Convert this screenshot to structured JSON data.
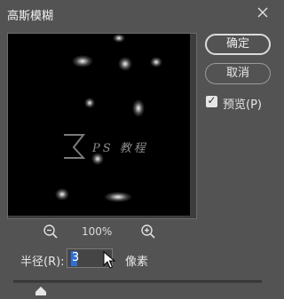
{
  "window": {
    "title": "高斯模糊"
  },
  "preview": {
    "zoom_level": "100%",
    "watermark_text": "PS 教程"
  },
  "buttons": {
    "ok": "确定",
    "cancel": "取消"
  },
  "preview_toggle": {
    "label": "预览(P)",
    "checked": true
  },
  "radius": {
    "label": "半径(R):",
    "value": "3",
    "unit": "像素",
    "slider_value": 3
  },
  "colors": {
    "background": "#535353",
    "preview": "#000000",
    "selection": "#2f6fd6"
  },
  "icons": [
    "close-icon",
    "zoom-out-icon",
    "zoom-in-icon",
    "checkmark-icon",
    "mouse-cursor-icon",
    "slider-thumb-icon"
  ]
}
